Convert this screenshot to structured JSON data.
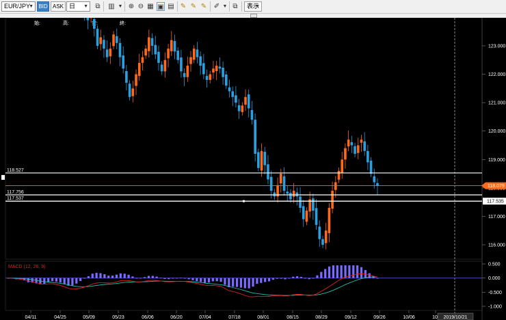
{
  "toolbar": {
    "symbol": "EUR/JPY",
    "bid_label": "BID",
    "ask_label": "ASK",
    "timeframe": "日",
    "display_label": "表示"
  },
  "chart_data": [
    {
      "type": "candlestick",
      "ohlc_header": [
        "始:",
        "高:",
        "安:",
        "終:"
      ],
      "ylim": [
        115.5,
        124.0
      ],
      "y_ticks": [
        "123.000",
        "122.000",
        "121.000",
        "120.000",
        "119.000",
        "118.000",
        "117.000",
        "116.000"
      ],
      "y_tick_values": [
        123.0,
        122.0,
        121.0,
        120.0,
        119.0,
        118.0,
        117.0,
        116.0
      ],
      "x_ticks": [
        "04/11",
        "04/25",
        "05/09",
        "05/23",
        "06/06",
        "06/20",
        "07/04",
        "07/18",
        "08/01",
        "08/15",
        "08/29",
        "09/12",
        "09/26",
        "10/06",
        "10/"
      ],
      "cursor_date_label": "2019/10/21",
      "current_price_label": "118.079",
      "current_price": 118.079,
      "horizontal_lines": [
        {
          "label": "118.527",
          "value": 118.527,
          "color": "#ffffff"
        },
        {
          "label": "117.756",
          "value": 117.756,
          "color": "#ffffff"
        },
        {
          "label": "117.537",
          "value": 117.537,
          "color": "#ffffff"
        },
        {
          "label": "117.535",
          "value": 117.535,
          "color": "#ffffff"
        }
      ],
      "colors": {
        "up": "#ff6a1a",
        "down": "#2aa0e0",
        "price_line": "#ff6a1a"
      },
      "closes": [
        124.3,
        124.1,
        123.9,
        124.0,
        123.6,
        123.0,
        123.3,
        122.9,
        122.6,
        122.9,
        123.4,
        123.1,
        122.6,
        122.2,
        121.7,
        121.2,
        121.5,
        122.0,
        122.4,
        122.6,
        122.9,
        123.3,
        123.0,
        122.7,
        122.4,
        122.1,
        122.5,
        122.9,
        123.2,
        122.8,
        122.5,
        122.1,
        121.9,
        122.3,
        122.6,
        122.9,
        122.6,
        122.3,
        122.0,
        121.8,
        122.0,
        122.2,
        122.3,
        122.2,
        121.9,
        121.6,
        121.4,
        121.2,
        121.0,
        120.7,
        120.9,
        121.2,
        120.8,
        120.4,
        119.2,
        118.7,
        119.3,
        118.8,
        118.3,
        117.9,
        117.7,
        118.1,
        118.5,
        117.9,
        117.8,
        117.6,
        117.9,
        117.7,
        117.3,
        116.9,
        117.2,
        117.6,
        117.2,
        116.7,
        116.2,
        116.0,
        116.5,
        117.3,
        117.9,
        118.2,
        118.6,
        119.0,
        119.4,
        119.7,
        119.5,
        119.2,
        119.5,
        119.7,
        119.3,
        118.9,
        118.5,
        118.2,
        118.079
      ],
      "macd": {
        "label": "MACD (12, 26, 9)",
        "ylim": [
          -1.0,
          0.5
        ],
        "y_ticks": [
          "0.500",
          "0.000",
          "-0.500",
          "-1.000"
        ],
        "y_tick_values": [
          0.5,
          0.0,
          -0.5,
          -1.0
        ],
        "colors": {
          "histogram": "#7a6cff",
          "macd": "#e02020",
          "signal": "#20c0b0"
        }
      }
    }
  ]
}
